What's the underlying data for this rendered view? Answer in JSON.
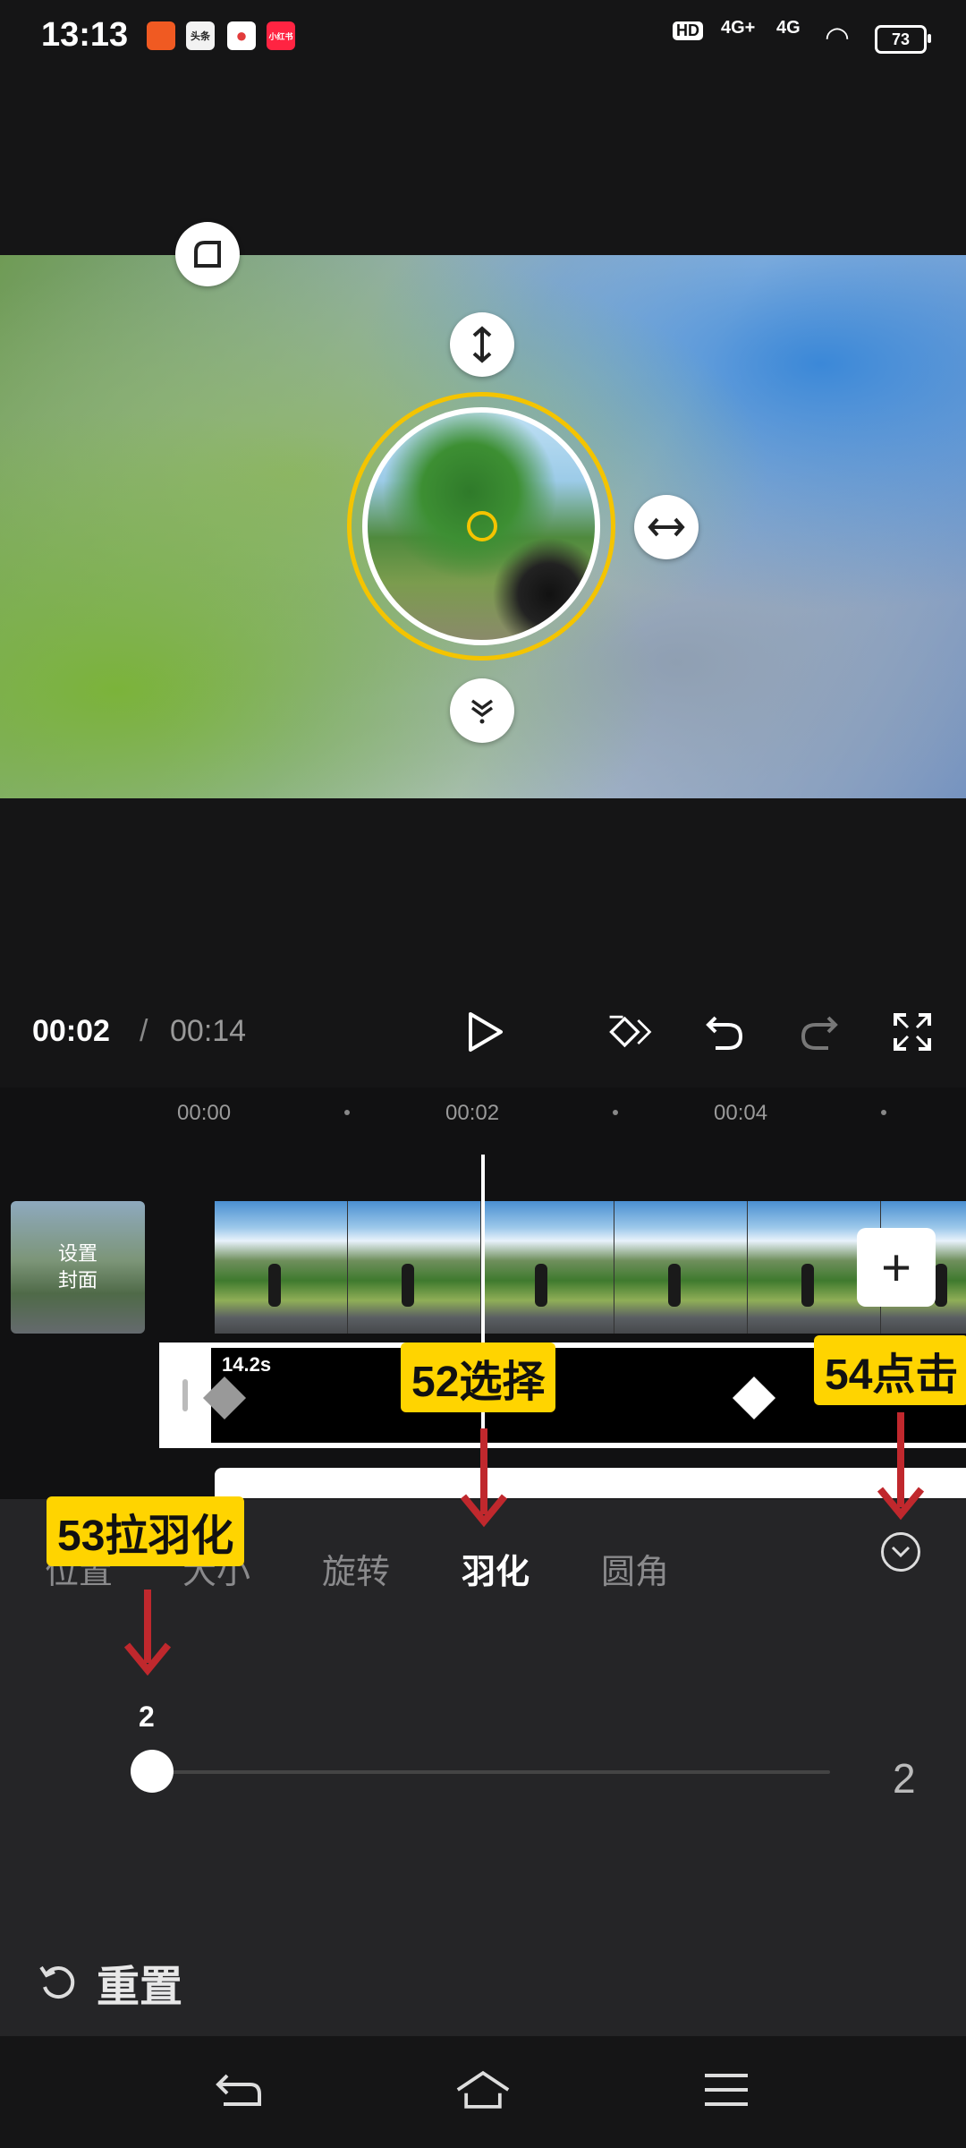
{
  "status_bar": {
    "time": "13:13",
    "apps": [
      {
        "name": "app-icon-1",
        "text": "",
        "color": "#f05a22"
      },
      {
        "name": "app-icon-2",
        "text": "头条",
        "color": "#d0d0d0"
      },
      {
        "name": "app-icon-3",
        "text": "",
        "color": "#e23b3b"
      },
      {
        "name": "app-icon-4",
        "text": "小红书",
        "color": "#ff2442"
      }
    ],
    "network_1": "4G+",
    "network_2": "4G",
    "hd": "HD",
    "battery": "73"
  },
  "playback": {
    "current_time": "00:02",
    "separator": "/",
    "total_time": "00:14"
  },
  "timeline": {
    "ticks": [
      "00:00",
      "00:02",
      "00:04"
    ],
    "cover_label": "设置\n封面",
    "clip_duration": "14.2s",
    "add_label": "+"
  },
  "tabs": [
    {
      "label": "位置",
      "active": false
    },
    {
      "label": "大小",
      "active": false
    },
    {
      "label": "旋转",
      "active": false
    },
    {
      "label": "羽化",
      "active": true
    },
    {
      "label": "圆角",
      "active": false
    }
  ],
  "slider": {
    "label_value": "2",
    "right_value": "2",
    "fraction": 0.0
  },
  "reset_label": "重置",
  "annotations": {
    "step52": "52选择",
    "step53": "53拉羽化",
    "step54": "54点击"
  },
  "colors": {
    "accent_yellow": "#f4c400",
    "annotation_bg": "#ffd400",
    "arrow_red": "#c0282d",
    "panel_bg": "#252527"
  }
}
